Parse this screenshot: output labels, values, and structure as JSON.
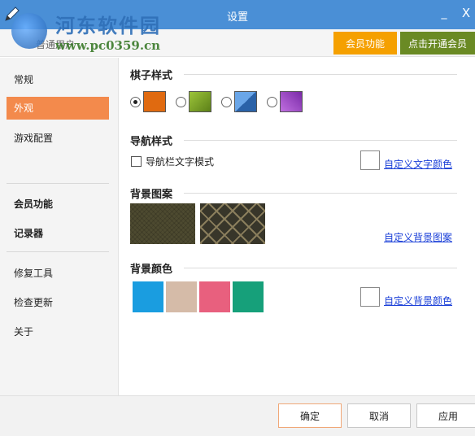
{
  "window": {
    "title": "设置",
    "minimize": "_",
    "close": "X"
  },
  "watermark": {
    "name": "河东软件园",
    "url": "www.pc0359.cn"
  },
  "header": {
    "user_type": "普通用户",
    "member_button": "会员功能",
    "open_member_button": "点击开通会员"
  },
  "sidebar": {
    "items": [
      {
        "label": "常规"
      },
      {
        "label": "外观",
        "active": true
      },
      {
        "label": "游戏配置"
      },
      {
        "label": "会员功能"
      },
      {
        "label": "记录器"
      },
      {
        "label": "修复工具"
      },
      {
        "label": "检查更新"
      },
      {
        "label": "关于"
      }
    ]
  },
  "main": {
    "chess_style": {
      "title": "棋子样式",
      "selected_index": 0,
      "options": [
        {
          "color": "#e06a10"
        },
        {
          "color": "#7aa02a"
        },
        {
          "color": "#3a78c0"
        },
        {
          "color": "#a048c8"
        }
      ]
    },
    "nav_style": {
      "title": "导航样式",
      "checkbox_label": "导航栏文字模式",
      "checked": false,
      "custom_link": "自定义文字颜色"
    },
    "bg_pattern": {
      "title": "背景图案",
      "custom_link": "自定义背景图案"
    },
    "bg_color": {
      "title": "背景颜色",
      "colors": [
        "#1a9de0",
        "#d5bba8",
        "#e8607e",
        "#16a07a"
      ],
      "custom_link": "自定义背景颜色"
    }
  },
  "footer": {
    "ok": "确定",
    "cancel": "取消",
    "apply": "应用"
  }
}
